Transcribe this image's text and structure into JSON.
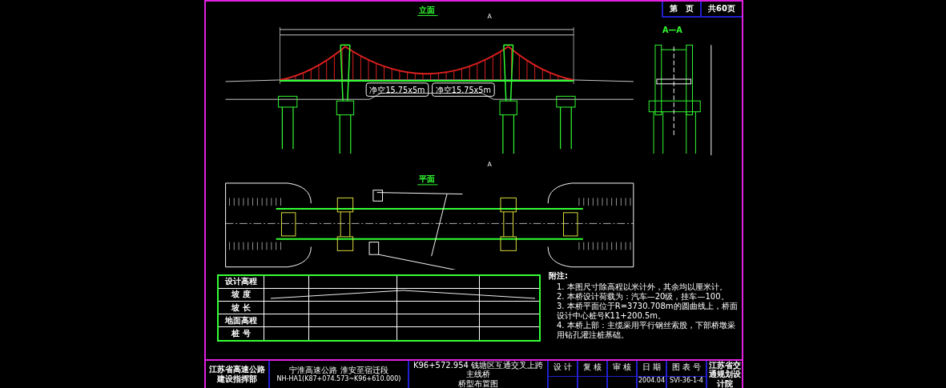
{
  "sheet": {
    "page_label": "第　页",
    "total": "共60页"
  },
  "elevation": {
    "title": "立面",
    "clearance_labels": [
      "净空15.75x5m",
      "净空15.75x5m"
    ],
    "section_marks": [
      "A",
      "A"
    ]
  },
  "section": {
    "title": "A—A"
  },
  "plan": {
    "title": "平面"
  },
  "profile_table": {
    "row_headers": [
      "设计高程",
      "坡 度",
      "坡 长",
      "地面高程",
      "桩 号"
    ]
  },
  "notes": {
    "heading": "附注:",
    "items": [
      "1. 本图尺寸除高程以米计外，其余均以厘米计。",
      "2. 本桥设计荷载为：汽车—20级，挂车—100。",
      "3. 本桥平面位于R=3730.708m的圆曲线上，桥面设计中心桩号K11+200.5m。",
      "4. 本桥上部：主缆采用平行钢丝索股，下部桥墩采用钻孔灌注桩基础。"
    ]
  },
  "title_block": {
    "organization": "江苏省高速公路建设指挥部",
    "project": "宁淮高速公路 淮安至宿迁段",
    "section": "NH-HA1(K87+074.573~K96+610.000)",
    "drawing_title": "K96+572.954 钱塘区互通交叉上跨主线桥",
    "drawing_subtitle": "桥型布置图",
    "designed": "设 计",
    "checked": "复 核",
    "approved": "审 核",
    "date_label": "日 期",
    "date": "2004.04",
    "number_label": "图 表 号",
    "number": "SVI-36-1-4",
    "institute": "江苏省交通规划设计院"
  }
}
